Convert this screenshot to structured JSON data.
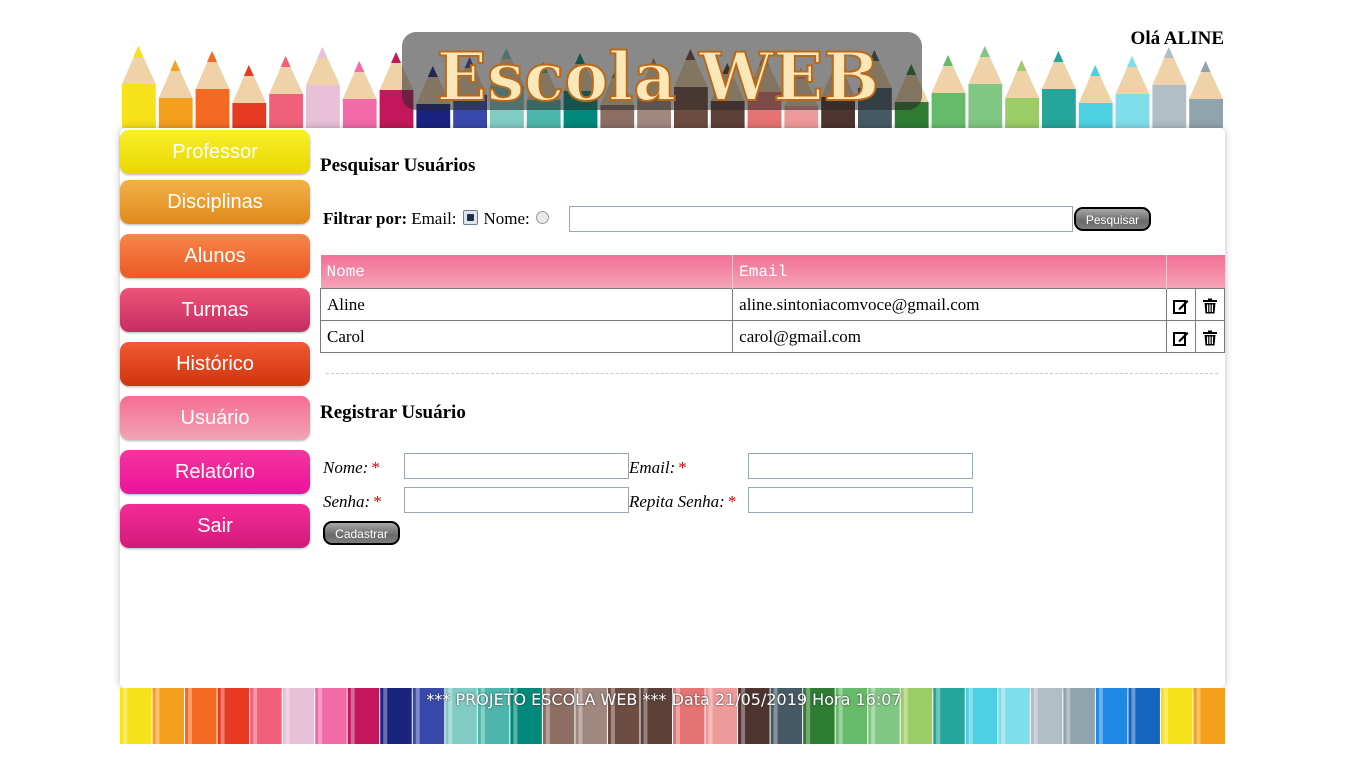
{
  "header": {
    "logo_text": "Escola WEB",
    "greeting": "Olá ALINE"
  },
  "menu": [
    {
      "label": "Professor",
      "color_top": "#f7f02a",
      "color_bottom": "#e9d600"
    },
    {
      "label": "Disciplinas",
      "color_top": "#f2b14a",
      "color_bottom": "#e08a1a"
    },
    {
      "label": "Alunos",
      "color_top": "#f7864a",
      "color_bottom": "#ec5a26"
    },
    {
      "label": "Turmas",
      "color_top": "#ee5478",
      "color_bottom": "#c72c63"
    },
    {
      "label": "Histórico",
      "color_top": "#f05a34",
      "color_bottom": "#d0340d"
    },
    {
      "label": "Usuário",
      "color_top": "#f46d92",
      "color_bottom": "#f2a3b7"
    },
    {
      "label": "Relatório",
      "color_top": "#f5359c",
      "color_bottom": "#ec129c"
    },
    {
      "label": "Sair",
      "color_top": "#f42b96",
      "color_bottom": "#d21a7a"
    }
  ],
  "search": {
    "title": "Pesquisar Usuários",
    "filter_label": "Filtrar por:",
    "option_email": "Email:",
    "option_nome": "Nome:",
    "selected": "Email",
    "query_value": "",
    "button_label": "Pesquisar"
  },
  "table": {
    "columns": [
      "Nome",
      "Email",
      ""
    ],
    "rows": [
      {
        "nome": "Aline",
        "email": "aline.sintoniacomvoce@gmail.com"
      },
      {
        "nome": "Carol",
        "email": "carol@gmail.com"
      }
    ]
  },
  "register": {
    "title": "Registrar Usuário",
    "nome_label": "Nome:",
    "email_label": "Email:",
    "senha_label": "Senha:",
    "repita_label": "Repita Senha:",
    "required_mark": "*",
    "nome_value": "",
    "email_value": "",
    "senha_value": "",
    "repita_value": "",
    "button_label": "Cadastrar"
  },
  "footer": {
    "text": "*** PROJETO ESCOLA WEB *** Data 21/05/2019 Hora 16:07"
  },
  "colors": {
    "table_header": "#f36f97",
    "required": "#cc0000"
  }
}
